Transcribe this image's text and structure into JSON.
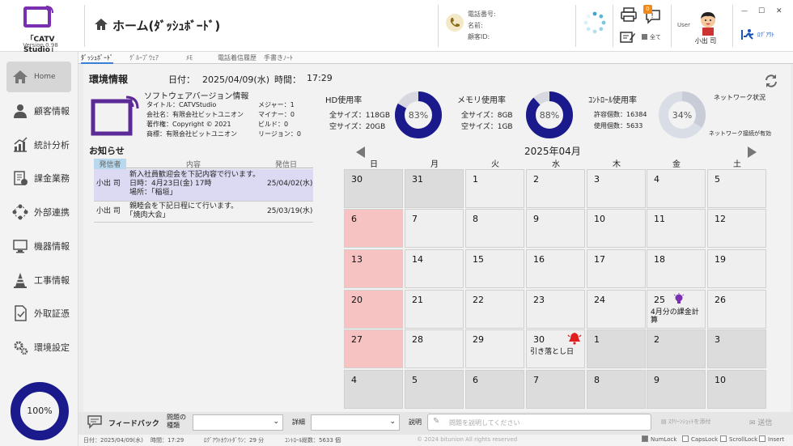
{
  "app": {
    "name": "「CATV Studio」",
    "version": "Version 0.98"
  },
  "header": {
    "title": "ホーム(ﾀﾞｯｼｭﾎﾞｰﾄﾞ)"
  },
  "customer": {
    "phone_label": "電話番号:",
    "name_label": "名前:",
    "id_label": "顧客ID:"
  },
  "toolbar": {
    "notification_count": "0",
    "all_label": "全て",
    "user_label": "User",
    "user_name": "小出 司",
    "logout_label": "ﾛｸﾞｱｳﾄ"
  },
  "window_controls": {
    "minimize": "—",
    "maximize": "☐",
    "close": "✕"
  },
  "tabs": [
    "ﾀﾞｯｼｭﾎﾞｰﾄﾞ",
    "ｸﾞﾙｰﾌﾟｳｪｱ",
    "ﾒﾓ",
    "電話着信履歴",
    "手書きﾉｰﾄ"
  ],
  "sidebar": {
    "items": [
      {
        "label": "Home"
      },
      {
        "label": "顧客情報"
      },
      {
        "label": "統計分析"
      },
      {
        "label": "課金業務"
      },
      {
        "label": "外部連携"
      },
      {
        "label": "機器情報"
      },
      {
        "label": "工事情報"
      },
      {
        "label": "外取証憑"
      },
      {
        "label": "環境設定"
      }
    ],
    "progress_label": "100%",
    "progress_value": 1.0
  },
  "env": {
    "title": "環境情報",
    "date_label": "日付：",
    "date": "2025/04/09(水)",
    "time_label": "時間：",
    "time": "17:29"
  },
  "software": {
    "title": "ソフトウェアバージョン情報",
    "lines": [
      "タイトル：CATVStudio",
      "会社名：有限会社ビットユニオン",
      "著作権：Copyright © 2021",
      "商標：有限会社ビットユニオン"
    ],
    "versions": [
      "メジャー：1",
      "マイナー：0",
      "ビルド：0",
      "リージョン：0"
    ]
  },
  "usage": {
    "hd": {
      "title": "HD使用率",
      "total": "全サイズ：118GB",
      "free": "空サイズ：20GB",
      "percent_label": "83%",
      "value": 0.83
    },
    "mem": {
      "title": "メモリ使用率",
      "total": "全サイズ：8GB",
      "free": "空サイズ：1GB",
      "percent_label": "88%",
      "value": 0.88
    },
    "ctrl": {
      "title": "ｺﾝﾄﾛｰﾙ使用率",
      "allowed": "許容個数：16384",
      "used": "使用個数：5633",
      "percent_label": "34%",
      "value": 0.34
    },
    "net": {
      "title": "ネットワーク状況",
      "status": "ネットワーク接続が有効"
    }
  },
  "news": {
    "title": "お知らせ",
    "headers": [
      "発信者",
      "内容",
      "発信日"
    ],
    "rows": [
      {
        "sender": "小出 司",
        "content": [
          "新入社員歓迎会を下記内容で行います。",
          "日時：4月23日(金) 17時",
          "場所：｢稲垣｣"
        ],
        "date": "25/04/02(水)"
      },
      {
        "sender": "小出 司",
        "content": [
          "親睦会を下記日程にて行います。",
          "｢焼肉大会｣"
        ],
        "date": "25/03/19(水)"
      }
    ]
  },
  "calendar": {
    "title": "2025年04月",
    "weekdays": [
      "日",
      "月",
      "火",
      "水",
      "木",
      "金",
      "土"
    ],
    "weeks": [
      [
        "30",
        "31",
        "1",
        "2",
        "3",
        "4",
        "5"
      ],
      [
        "6",
        "7",
        "8",
        "9",
        "10",
        "11",
        "12"
      ],
      [
        "13",
        "14",
        "15",
        "16",
        "17",
        "18",
        "19"
      ],
      [
        "20",
        "21",
        "22",
        "23",
        "24",
        "25",
        "26"
      ],
      [
        "27",
        "28",
        "29",
        "30",
        "1",
        "2",
        "3"
      ],
      [
        "4",
        "5",
        "6",
        "7",
        "8",
        "9",
        "10"
      ]
    ],
    "events": {
      "25": "4月分の課金計算",
      "30": "引き落とし日"
    }
  },
  "feedback": {
    "label": "フィードバック",
    "problem_label": "問題の種類",
    "detail_label": "詳細",
    "desc_label": "説明",
    "desc_placeholder": "問題を説明してください",
    "attach_label": "ｽｸﾘｰﾝｼｮｯﾄを添付",
    "send_label": "送信"
  },
  "status": {
    "date": "日付：2025/04/09(水)",
    "time": "時間：17:29",
    "logout_count": "ﾛｸﾞｱｳﾄｶｳﾝﾄﾀﾞｳﾝ：29 分",
    "ctrl_total": "ｺﾝﾄﾛｰﾙ総数：5633 個",
    "copyright": "© 2024 bitunion All rights reserved",
    "numlock": "NumLock",
    "capslock": "CapsLock",
    "scrolllock": "ScrollLock",
    "insert": "Insert"
  },
  "colors": {
    "accent": "#1a1a8c",
    "sunday": "#f7c2c2",
    "purple": "#6a2fa0",
    "alarm": "#e02020"
  }
}
